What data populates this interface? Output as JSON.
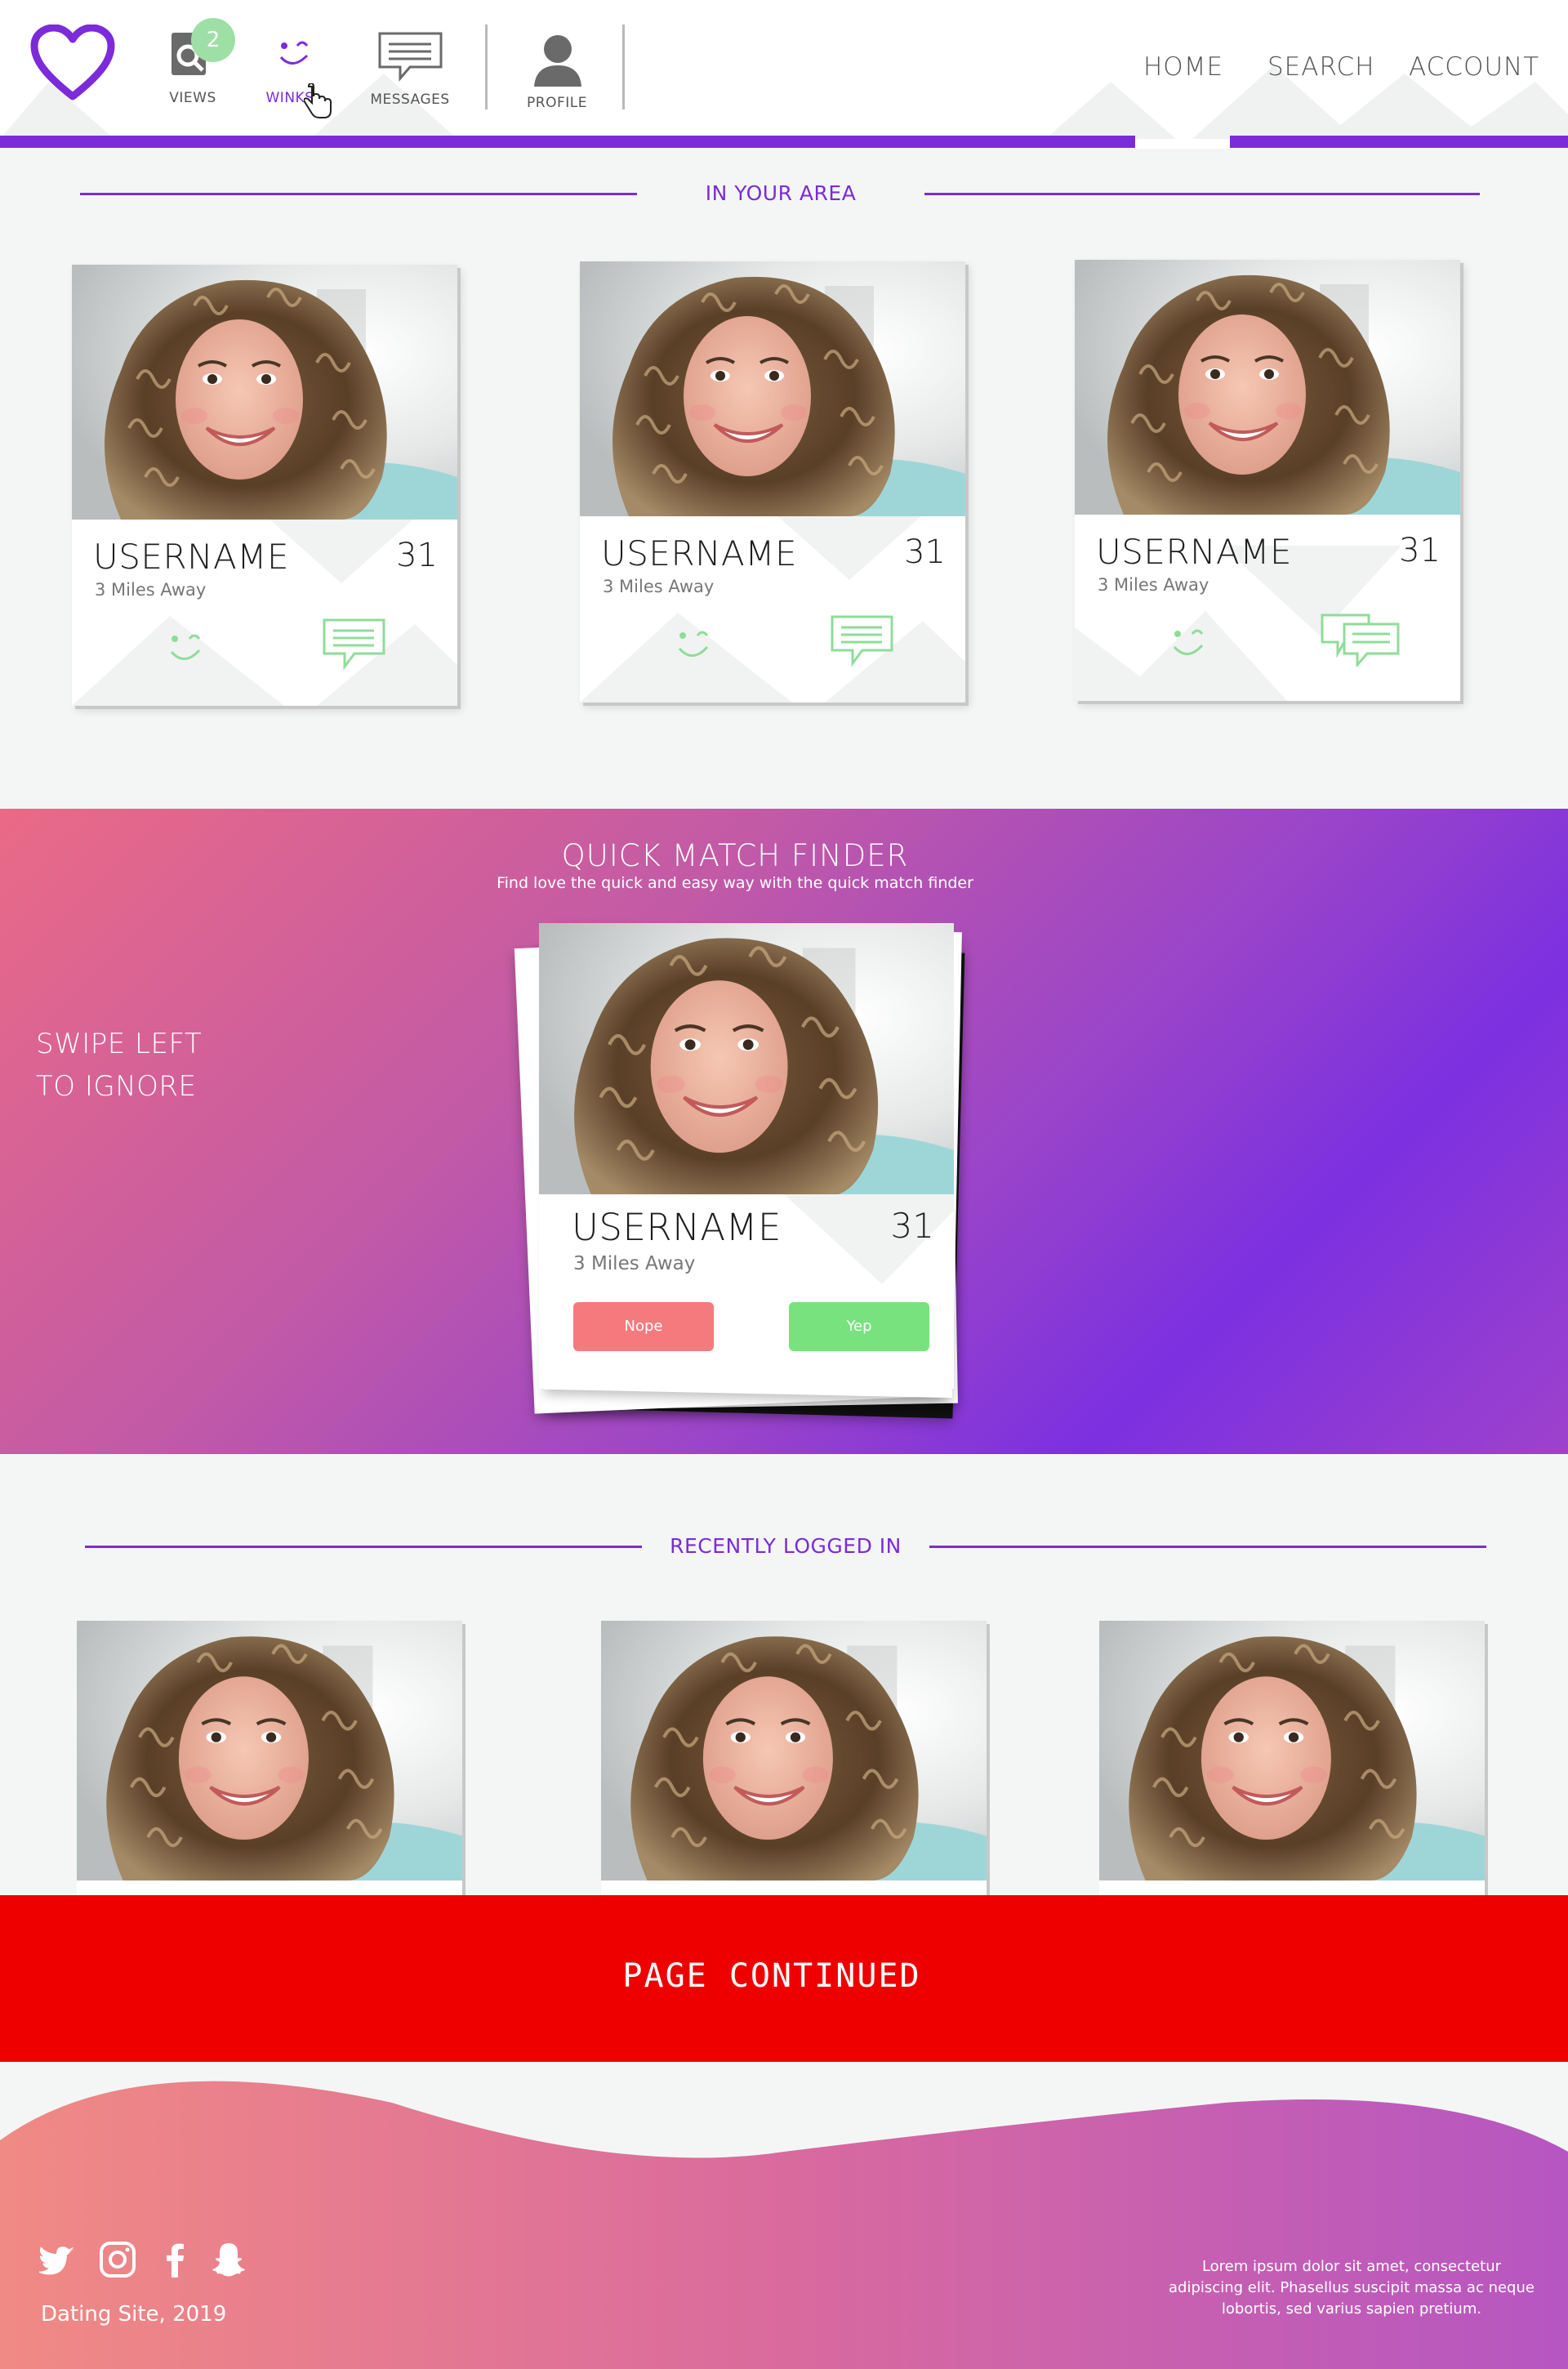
{
  "colors": {
    "accent": "#7b2bd9",
    "green": "#9edfa6",
    "nope": "#f47a7e",
    "yep": "#77e27e",
    "banner": "#ee0000"
  },
  "header": {
    "logo_icon": "heart-icon",
    "views": {
      "label": "VIEWS",
      "badge": "2",
      "icon": "search-icon"
    },
    "winks": {
      "label": "WINKS",
      "icon": "wink-icon"
    },
    "messages": {
      "label": "MESSAGES",
      "icon": "message-icon"
    },
    "profile": {
      "label": "PROFILE",
      "icon": "user-icon"
    },
    "links": {
      "home": "HOME",
      "search": "SEARCH",
      "account": "ACCOUNT"
    }
  },
  "area": {
    "title": "IN YOUR AREA",
    "cards": [
      {
        "username": "USERNAME",
        "age": "31",
        "distance": "3 Miles Away"
      },
      {
        "username": "USERNAME",
        "age": "31",
        "distance": "3 Miles Away"
      },
      {
        "username": "USERNAME",
        "age": "31",
        "distance": "3 Miles Away"
      }
    ]
  },
  "quick_match": {
    "title": "QUICK MATCH FINDER",
    "subtitle": "Find love the quick and easy way with the quick match finder",
    "swipe_line1": "SWIPE LEFT",
    "swipe_line2": "TO IGNORE",
    "card": {
      "username": "USERNAME",
      "age": "31",
      "distance": "3 Miles Away",
      "nope": "Nope",
      "yep": "Yep"
    }
  },
  "recent": {
    "title": "RECENTLY LOGGED IN"
  },
  "continued": {
    "label": "PAGE CONTINUED"
  },
  "footer": {
    "copyright": "Dating Site, 2019",
    "lorem": "Lorem ipsum dolor sit amet, consectetur adipiscing elit. Phasellus suscipit massa ac neque lobortis, sed varius sapien pretium.",
    "social": [
      "twitter-icon",
      "instagram-icon",
      "facebook-icon",
      "snapchat-icon"
    ]
  }
}
